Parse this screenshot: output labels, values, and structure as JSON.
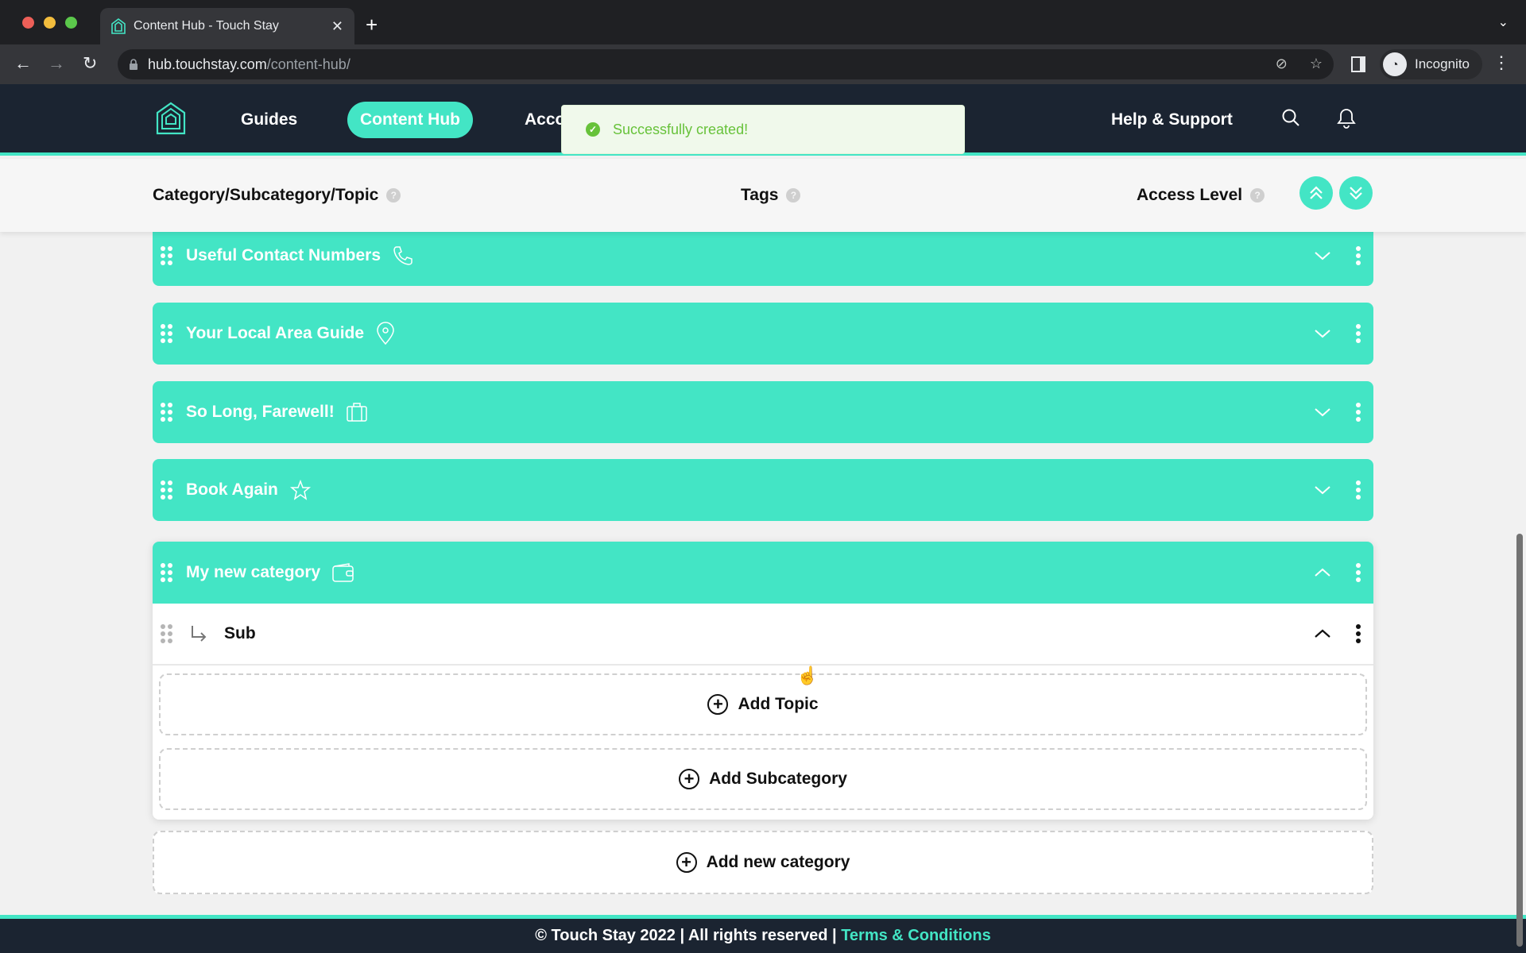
{
  "browser": {
    "tab_title": "Content Hub - Touch Stay",
    "url_host": "hub.touchstay.com",
    "url_path": "/content-hub/",
    "profile_label": "Incognito"
  },
  "header": {
    "nav": [
      {
        "label": "Guides",
        "active": false
      },
      {
        "label": "Content Hub",
        "active": true
      },
      {
        "label": "Acco",
        "active": false
      }
    ],
    "help_label": "Help & Support"
  },
  "toast": {
    "message": "Successfully created!",
    "type": "success"
  },
  "columns": {
    "category": "Category/Subcategory/Topic",
    "tags": "Tags",
    "access": "Access Level",
    "help_glyph": "?"
  },
  "categories": [
    {
      "title": "Useful Contact Numbers",
      "icon": "phone-icon",
      "expanded": false
    },
    {
      "title": "Your Local Area Guide",
      "icon": "map-pin-icon",
      "expanded": false
    },
    {
      "title": "So Long, Farewell!",
      "icon": "suitcase-icon",
      "expanded": false
    },
    {
      "title": "Book Again",
      "icon": "star-icon",
      "expanded": false
    },
    {
      "title": "My new category",
      "icon": "wallet-icon",
      "expanded": true,
      "subcategories": [
        {
          "title": "Sub",
          "expanded": true
        }
      ]
    }
  ],
  "actions": {
    "add_topic": "Add Topic",
    "add_subcategory": "Add Subcategory",
    "add_category": "Add new category"
  },
  "footer": {
    "copyright": "© Touch Stay 2022 | All rights reserved | ",
    "terms": "Terms & Conditions"
  },
  "colors": {
    "accent": "#43e5c5",
    "header_bg": "#1b2431",
    "success": "#67c23a"
  }
}
